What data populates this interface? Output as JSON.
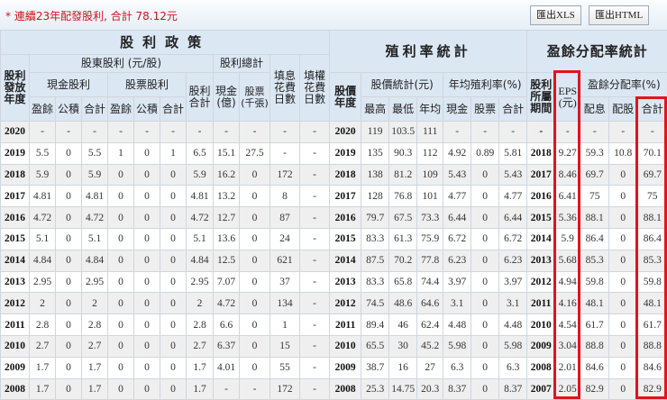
{
  "toolbar": {
    "notice": "* 連續23年配發股利, 合計 78.12元",
    "export_xls": "匯出XLS",
    "export_html": "匯出HTML"
  },
  "header": {
    "policy": "股利政策",
    "yield_stats": "殖利率統計",
    "payout_stats": "盈餘分配率統計",
    "issue_year": "股利發放年度",
    "shareholder_dividend": "股東股利 (元/股)",
    "dividend_total": "股利總計",
    "fill_div_days": "填息花費日數",
    "fill_right_days": "填權花費日數",
    "cash_dividend": "現金股利",
    "stock_dividend": "股票股利",
    "dividend_sum": "股利合計",
    "cash_100m": "現金(億)",
    "stock_k_lots": "股票(千張)",
    "earnings": "盈餘",
    "reserve": "公積",
    "sum": "合計",
    "price_year": "股價年度",
    "price_stats": "股價統計(元)",
    "avg_yield": "年均殖利率(%)",
    "high": "最高",
    "low": "最低",
    "avg": "年均",
    "cash": "現金",
    "stock": "股票",
    "period": "股利所屬期間",
    "eps": "EPS (元)",
    "payout_rate": "盈餘分配率(%)",
    "pay_cash": "配息",
    "pay_stock": "配股"
  },
  "rows": [
    [
      "2020",
      "-",
      "-",
      "-",
      "-",
      "-",
      "-",
      "-",
      "-",
      "-",
      "-",
      "-",
      "2020",
      "119",
      "103.5",
      "111",
      "-",
      "-",
      "-",
      "-",
      "-",
      "-",
      "-",
      "-"
    ],
    [
      "2019",
      "5.5",
      "0",
      "5.5",
      "1",
      "0",
      "1",
      "6.5",
      "15.1",
      "27.5",
      "-",
      "-",
      "2019",
      "135",
      "90.3",
      "112",
      "4.92",
      "0.89",
      "5.81",
      "2018",
      "9.27",
      "59.3",
      "10.8",
      "70.1"
    ],
    [
      "2018",
      "5.9",
      "0",
      "5.9",
      "0",
      "0",
      "0",
      "5.9",
      "16.2",
      "0",
      "172",
      "-",
      "2018",
      "138",
      "81.2",
      "109",
      "5.43",
      "0",
      "5.43",
      "2017",
      "8.46",
      "69.7",
      "0",
      "69.7"
    ],
    [
      "2017",
      "4.81",
      "0",
      "4.81",
      "0",
      "0",
      "0",
      "4.81",
      "13.2",
      "0",
      "8",
      "-",
      "2017",
      "128",
      "76.8",
      "101",
      "4.77",
      "0",
      "4.77",
      "2016",
      "6.41",
      "75",
      "0",
      "75"
    ],
    [
      "2016",
      "4.72",
      "0",
      "4.72",
      "0",
      "0",
      "0",
      "4.72",
      "12.7",
      "0",
      "87",
      "-",
      "2016",
      "79.7",
      "67.5",
      "73.3",
      "6.44",
      "0",
      "6.44",
      "2015",
      "5.36",
      "88.1",
      "0",
      "88.1"
    ],
    [
      "2015",
      "5.1",
      "0",
      "5.1",
      "0",
      "0",
      "0",
      "5.1",
      "13.6",
      "0",
      "24",
      "-",
      "2015",
      "83.3",
      "61.3",
      "75.9",
      "6.72",
      "0",
      "6.72",
      "2014",
      "5.9",
      "86.4",
      "0",
      "86.4"
    ],
    [
      "2014",
      "4.84",
      "0",
      "4.84",
      "0",
      "0",
      "0",
      "4.84",
      "12.5",
      "0",
      "621",
      "-",
      "2014",
      "87.5",
      "70.2",
      "77.8",
      "6.23",
      "0",
      "6.23",
      "2013",
      "5.68",
      "85.3",
      "0",
      "85.3"
    ],
    [
      "2013",
      "2.95",
      "0",
      "2.95",
      "0",
      "0",
      "0",
      "2.95",
      "7.07",
      "0",
      "37",
      "-",
      "2013",
      "83.3",
      "65.8",
      "74.4",
      "3.97",
      "0",
      "3.97",
      "2012",
      "4.94",
      "59.8",
      "0",
      "59.8"
    ],
    [
      "2012",
      "2",
      "0",
      "2",
      "0",
      "0",
      "0",
      "2",
      "4.72",
      "0",
      "134",
      "-",
      "2012",
      "74.5",
      "48.6",
      "64.6",
      "3.1",
      "0",
      "3.1",
      "2011",
      "4.16",
      "48.1",
      "0",
      "48.1"
    ],
    [
      "2011",
      "2.8",
      "0",
      "2.8",
      "0",
      "0",
      "0",
      "2.8",
      "6.6",
      "0",
      "1",
      "-",
      "2011",
      "89.4",
      "46",
      "62.4",
      "4.48",
      "0",
      "4.48",
      "2010",
      "4.54",
      "61.7",
      "0",
      "61.7"
    ],
    [
      "2010",
      "2.7",
      "0",
      "2.7",
      "0",
      "0",
      "0",
      "2.7",
      "6.37",
      "0",
      "15",
      "-",
      "2010",
      "65.5",
      "30",
      "45.2",
      "5.98",
      "0",
      "5.98",
      "2009",
      "3.04",
      "88.8",
      "0",
      "88.8"
    ],
    [
      "2009",
      "1.7",
      "0",
      "1.7",
      "0",
      "0",
      "0",
      "1.7",
      "4.01",
      "0",
      "55",
      "-",
      "2009",
      "38.7",
      "16",
      "27",
      "6.3",
      "0",
      "6.3",
      "2008",
      "2.01",
      "84.6",
      "0",
      "84.6"
    ],
    [
      "2008",
      "1.7",
      "0",
      "1.7",
      "0",
      "0",
      "0",
      "1.7",
      "-",
      "-",
      "172",
      "-",
      "2008",
      "25.3",
      "14.75",
      "20.3",
      "8.37",
      "0",
      "8.37",
      "2007",
      "2.05",
      "82.9",
      "0",
      "82.9"
    ]
  ]
}
